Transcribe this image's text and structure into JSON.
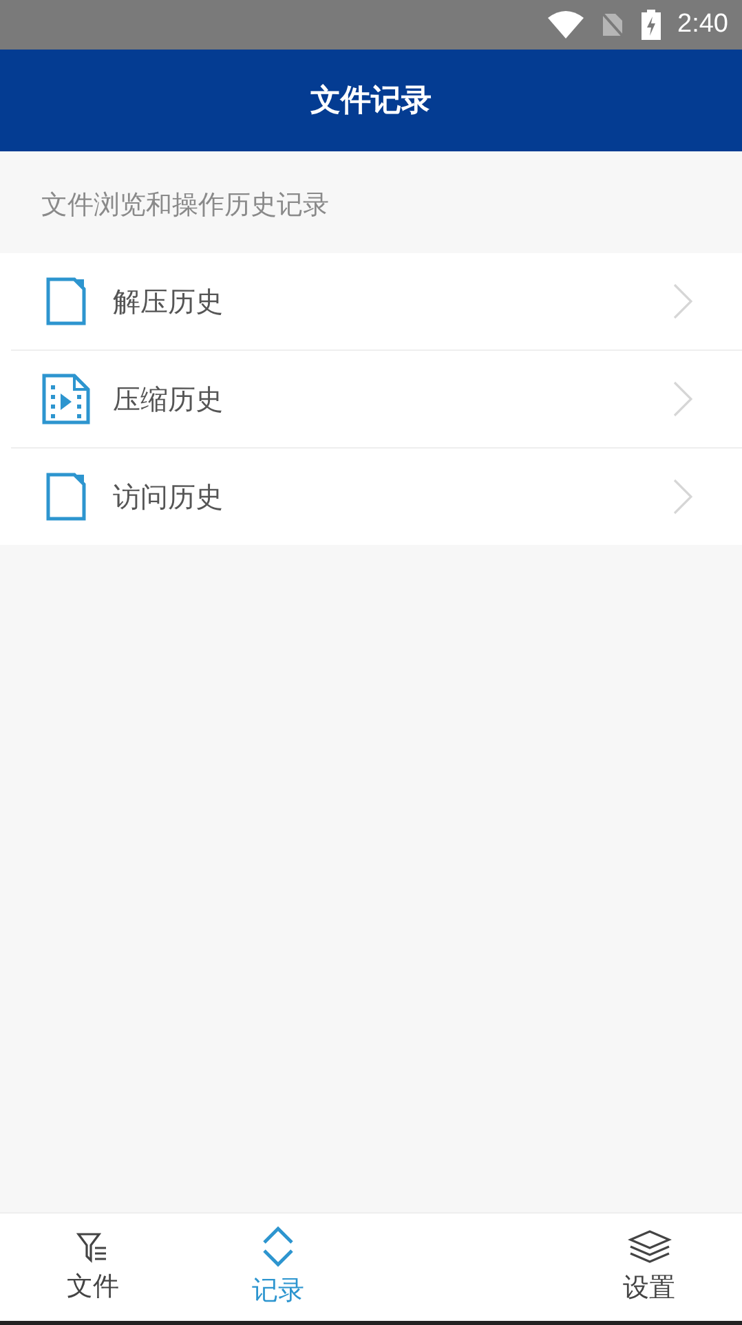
{
  "status_bar": {
    "time": "2:40"
  },
  "header": {
    "title": "文件记录"
  },
  "section": {
    "caption": "文件浏览和操作历史记录"
  },
  "items": [
    {
      "label": "解压历史",
      "kind": "document"
    },
    {
      "label": "压缩历史",
      "kind": "video"
    },
    {
      "label": "访问历史",
      "kind": "document"
    }
  ],
  "tabs": [
    {
      "label": "文件",
      "kind": "filter",
      "selected": false
    },
    {
      "label": "记录",
      "kind": "updown",
      "selected": true
    },
    {
      "label": "设置",
      "kind": "layers",
      "selected": false
    }
  ]
}
